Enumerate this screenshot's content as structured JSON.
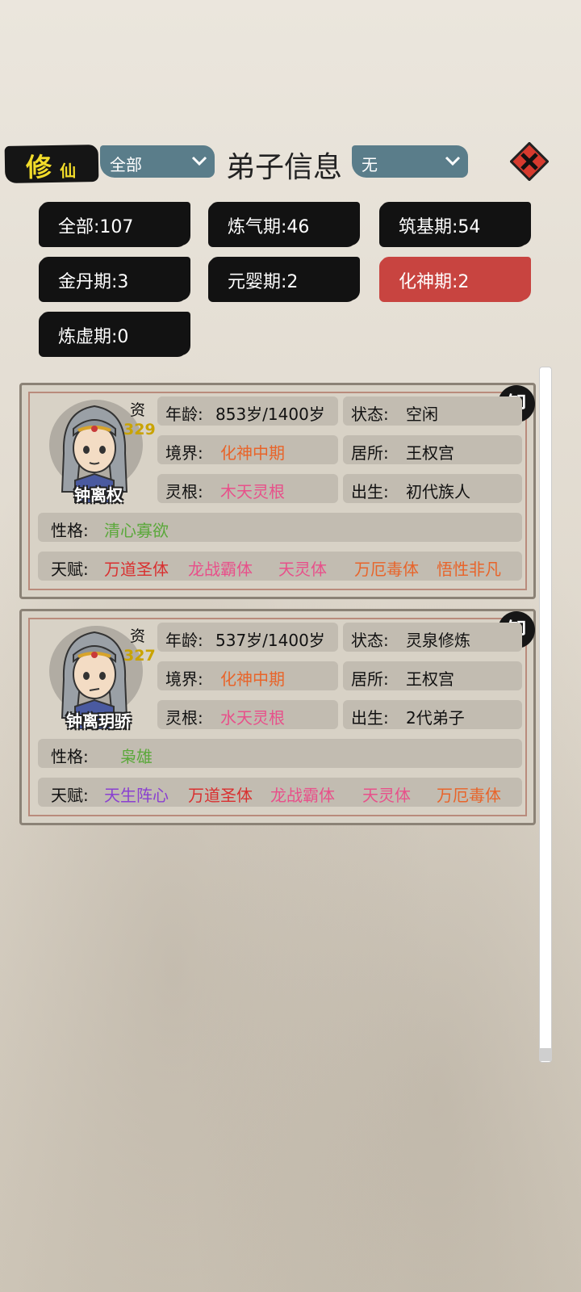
{
  "header": {
    "logo_big": "修",
    "logo_small": "仙",
    "filter_left": "全部",
    "title": "弟子信息",
    "filter_right": "无"
  },
  "stages": [
    {
      "label": "全部:107"
    },
    {
      "label": "炼气期:46"
    },
    {
      "label": "筑基期:54"
    },
    {
      "label": "金丹期:3"
    },
    {
      "label": "元婴期:2"
    },
    {
      "label": "化神期:2"
    },
    {
      "label": "炼虚期:0"
    }
  ],
  "disciples": [
    {
      "seal": "卸",
      "zi_label": "资",
      "aptitude": "329",
      "name": "钟离权",
      "age_label": "年龄:",
      "age": "853岁/1400岁",
      "status_label": "状态:",
      "status": "空闲",
      "realm_label": "境界:",
      "realm": "化神中期",
      "residence_label": "居所:",
      "residence": "王权宫",
      "root_label": "灵根:",
      "root": "木天灵根",
      "birth_label": "出生:",
      "birth": "初代族人",
      "personality_label": "性格:",
      "personality": "清心寡欲",
      "talent_label": "天赋:",
      "talents": [
        "万道圣体",
        "龙战霸体",
        "天灵体",
        "万厄毒体",
        "悟性非凡"
      ]
    },
    {
      "seal": "卸",
      "zi_label": "资",
      "aptitude": "327",
      "name": "钟离玥骄",
      "age_label": "年龄:",
      "age": "537岁/1400岁",
      "status_label": "状态:",
      "status": "灵泉修炼",
      "realm_label": "境界:",
      "realm": "化神中期",
      "residence_label": "居所:",
      "residence": "王权宫",
      "root_label": "灵根:",
      "root": "水天灵根",
      "birth_label": "出生:",
      "birth": "2代弟子",
      "personality_label": "性格:",
      "personality": "枭雄",
      "talent_label": "天赋:",
      "talents": [
        "天生阵心",
        "万道圣体",
        "龙战霸体",
        "天灵体",
        "万厄毒体"
      ]
    }
  ],
  "colors": {
    "active_chip": "#c84440",
    "aptitude": "#c9a300",
    "realm": "#e8642a",
    "root": "#e8508a",
    "personality": "#5aa83a"
  }
}
